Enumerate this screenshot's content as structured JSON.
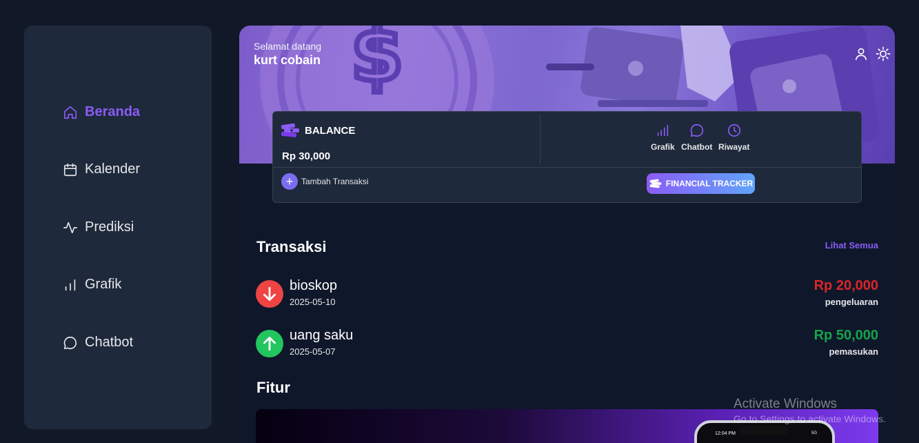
{
  "sidebar": {
    "items": [
      {
        "label": "Beranda",
        "icon": "home-icon",
        "active": true
      },
      {
        "label": "Kalender",
        "icon": "calendar-icon",
        "active": false
      },
      {
        "label": "Prediksi",
        "icon": "activity-icon",
        "active": false
      },
      {
        "label": "Grafik",
        "icon": "bar-chart-icon",
        "active": false
      },
      {
        "label": "Chatbot",
        "icon": "chat-bubble-icon",
        "active": false
      }
    ]
  },
  "header": {
    "greeting": "Selamat datang",
    "username": "kurt cobain"
  },
  "balance_card": {
    "title": "BALANCE",
    "amount": "Rp 30,000",
    "quick_actions": [
      {
        "label": "Grafik",
        "icon": "bar-chart-icon"
      },
      {
        "label": "Chatbot",
        "icon": "chat-bubble-icon"
      },
      {
        "label": "Riwayat",
        "icon": "clock-icon"
      }
    ],
    "add_label": "Tambah Transaksi",
    "tracker_label": "FINANCIAL TRACKER"
  },
  "transactions": {
    "title": "Transaksi",
    "see_all": "Lihat Semua",
    "items": [
      {
        "name": "bioskop",
        "date": "2025-05-10",
        "amount": "Rp 20,000",
        "type": "pengeluaran",
        "direction": "down",
        "color": "#dc2626"
      },
      {
        "name": "uang saku",
        "date": "2025-05-07",
        "amount": "Rp 50,000",
        "type": "pemasukan",
        "direction": "up",
        "color": "#16a34a"
      }
    ]
  },
  "features": {
    "title": "Fitur",
    "phone_time": "12:04 PM",
    "phone_status": "5G"
  },
  "watermark": {
    "line1": "Activate Windows",
    "line2": "Go to Settings to activate Windows."
  },
  "colors": {
    "accent": "#8b5cf6",
    "expense": "#dc2626",
    "income": "#16a34a",
    "background": "#111827",
    "card": "#1e293b"
  }
}
